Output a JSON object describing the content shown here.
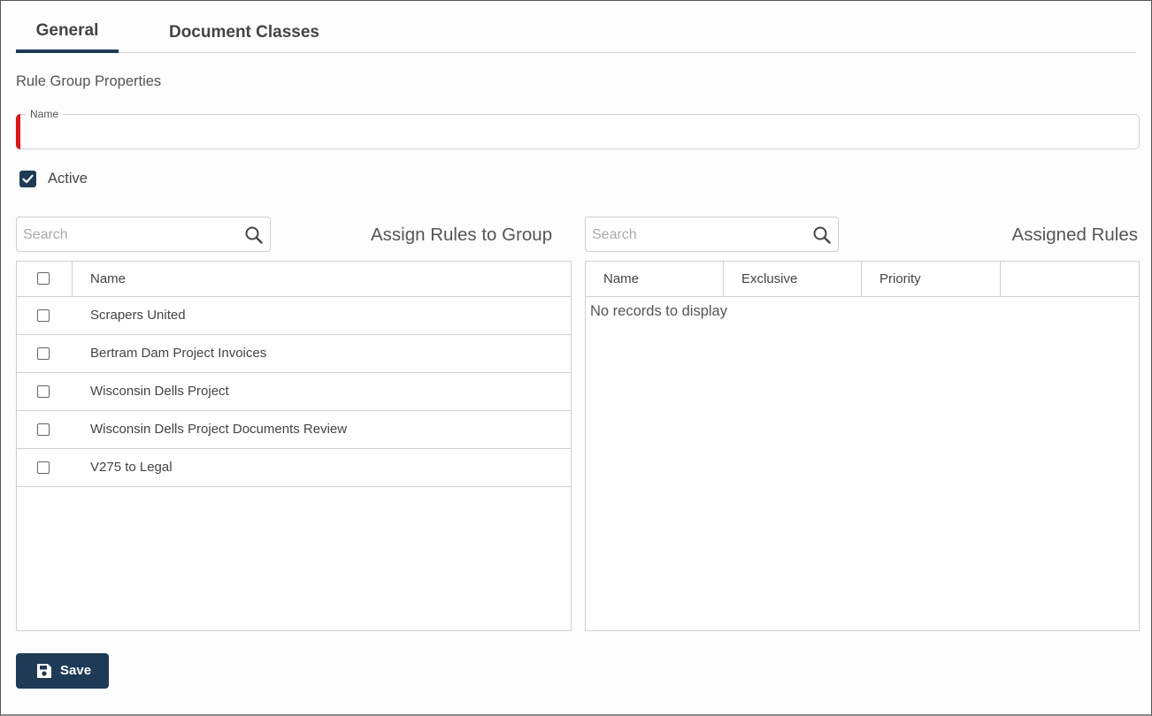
{
  "tabs": [
    {
      "label": "General",
      "active": true
    },
    {
      "label": "Document Classes",
      "active": false
    }
  ],
  "section_title": "Rule Group Properties",
  "name_field": {
    "legend": "Name",
    "value": "",
    "required": true
  },
  "active": {
    "label": "Active",
    "checked": true
  },
  "left_panel": {
    "search_placeholder": "Search",
    "heading": "Assign Rules to Group",
    "column_name": "Name",
    "rows": [
      {
        "name": "Scrapers United",
        "checked": false
      },
      {
        "name": "Bertram Dam Project Invoices",
        "checked": false
      },
      {
        "name": "Wisconsin Dells Project",
        "checked": false
      },
      {
        "name": "Wisconsin Dells Project Documents Review",
        "checked": false
      },
      {
        "name": "V275 to Legal",
        "checked": false
      }
    ]
  },
  "right_panel": {
    "search_placeholder": "Search",
    "heading": "Assigned Rules",
    "columns": [
      "Name",
      "Exclusive",
      "Priority"
    ],
    "empty_message": "No records to display"
  },
  "save_button": {
    "label": "Save"
  },
  "colors": {
    "primary": "#1d3b57",
    "required": "#e81010"
  },
  "icons": {
    "search": "search-icon",
    "save": "floppy-disk-icon",
    "check": "check-icon"
  }
}
